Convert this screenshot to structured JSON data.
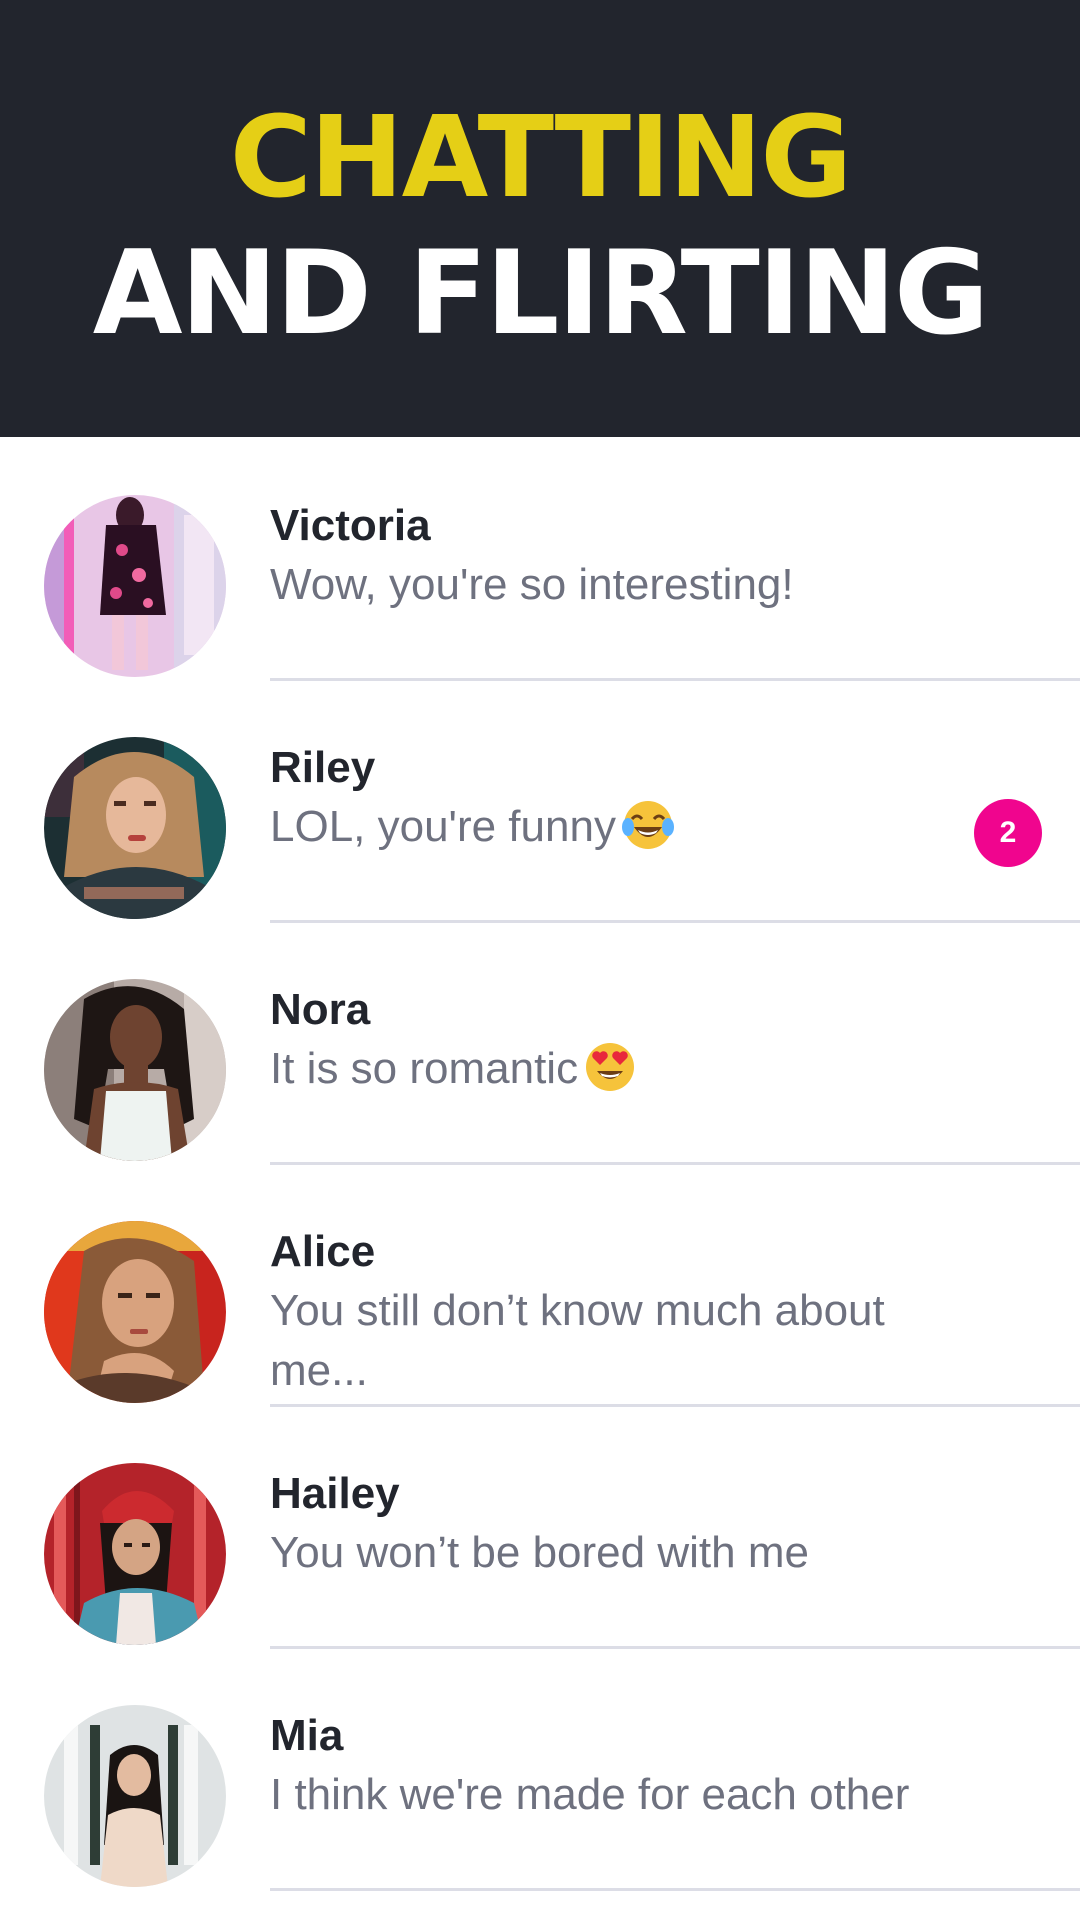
{
  "header": {
    "line1": "CHATTING",
    "line2": "AND FLIRTING",
    "line1_color": "#e5cf16",
    "line2_color": "#ffffff",
    "background": "#22252d"
  },
  "chats": [
    {
      "name": "Victoria",
      "message": "Wow, you're so interesting!",
      "emoji": "",
      "unread": ""
    },
    {
      "name": "Riley",
      "message": "LOL, you're funny",
      "emoji": "tears-of-joy-emoji",
      "unread": "2"
    },
    {
      "name": "Nora",
      "message": "It is so romantic",
      "emoji": "heart-eyes-emoji",
      "unread": ""
    },
    {
      "name": "Alice",
      "message": "You still don’t know much about me...",
      "emoji": "",
      "unread": ""
    },
    {
      "name": "Hailey",
      "message": "You won’t be bored with me",
      "emoji": "",
      "unread": ""
    },
    {
      "name": "Mia",
      "message": "I think we're made for each other",
      "emoji": "",
      "unread": ""
    }
  ],
  "colors": {
    "name": "#22252d",
    "message": "#6e717f",
    "badge": "#f0058e",
    "divider": "#dcdde6"
  }
}
